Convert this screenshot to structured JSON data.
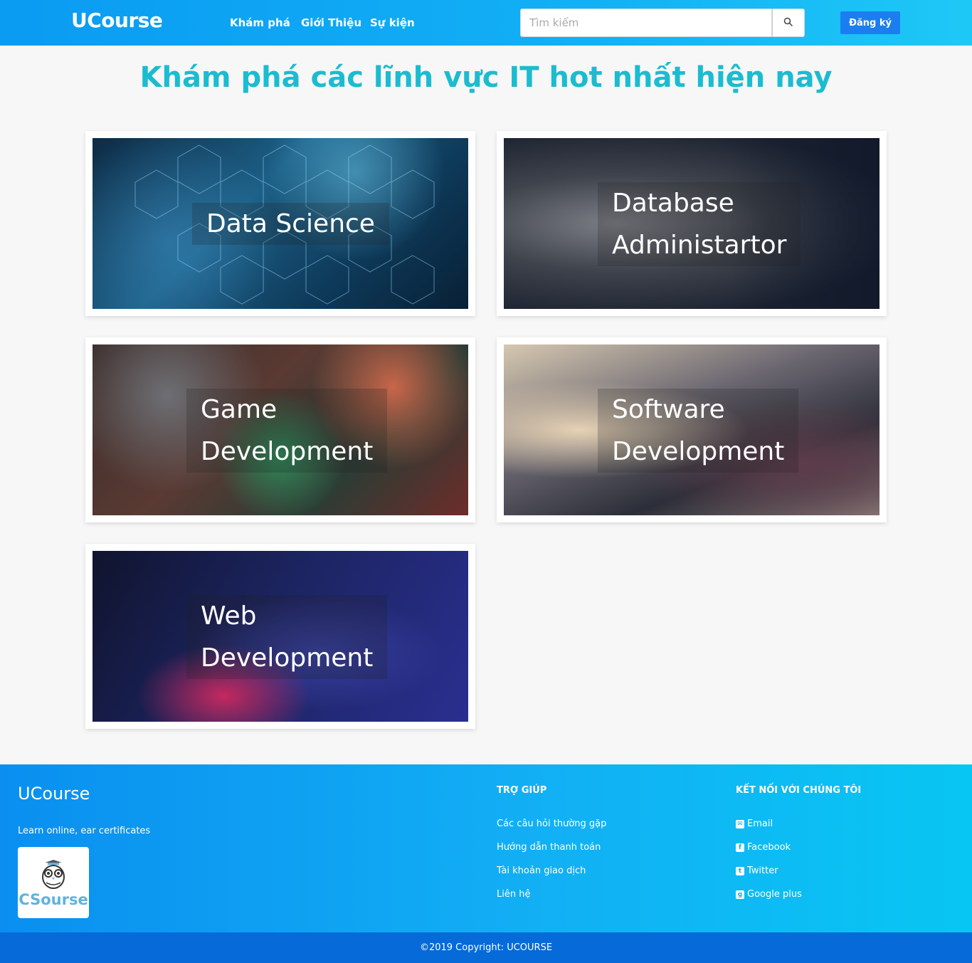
{
  "header": {
    "logo": "UCourse",
    "nav": [
      "Khám phá",
      "Giới Thiệu",
      "Sự kiện"
    ],
    "search_placeholder": "Tìm kiếm",
    "signup_label": "Đăng ký"
  },
  "main": {
    "title": "Khám phá các lĩnh vực IT hot nhất hiện nay",
    "cards": [
      {
        "line1": "Data Science",
        "line2": ""
      },
      {
        "line1": "Database",
        "line2": "Administartor"
      },
      {
        "line1": "Game",
        "line2": "Development"
      },
      {
        "line1": "Software",
        "line2": "Development"
      },
      {
        "line1": "Web",
        "line2": "Development"
      }
    ]
  },
  "footer": {
    "logo": "UCourse",
    "tagline": "Learn online, ear certificates",
    "badge_text": "CSourse",
    "help_heading": "TRỢ GIÚP",
    "help_links": [
      "Các câu hỏi thường gặp",
      "Hướng dẫn thanh toán",
      "Tài khoản giao dịch",
      "Liên hệ"
    ],
    "connect_heading": "KẾT NỐI VỚI CHÚNG TÔI",
    "connect_links": [
      "Email",
      "Facebook",
      "Twitter",
      "Google plus"
    ],
    "copyright": "©2019 Copyright: UCOURSE"
  },
  "icons": {
    "search": "search-icon",
    "email": "envelope-icon",
    "facebook": "facebook-icon",
    "twitter": "twitter-icon",
    "google_plus": "google-plus-icon",
    "badge": "owl-icon"
  },
  "colors": {
    "header_gradient_start": "#0a9bf2",
    "accent_title": "#1bbcd0",
    "signup_button": "#1b7ef0",
    "copyright_bar": "#066ad9"
  }
}
